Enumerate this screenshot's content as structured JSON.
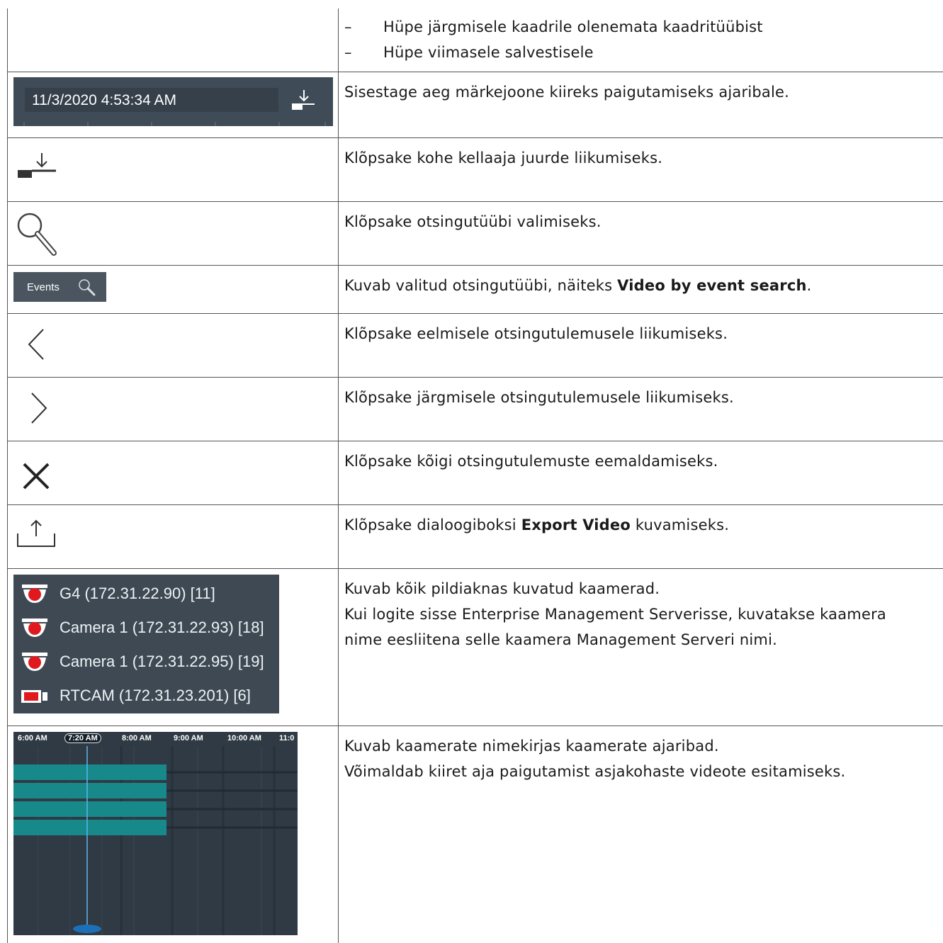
{
  "rows": [
    {
      "bullets": [
        "Hüpe järgmisele kaadrile olenemata kaadritüübist",
        "Hüpe viimasele salvestisele"
      ]
    },
    {
      "text": "Sisestage aeg märkejoone kiireks paigutamiseks ajaribale."
    },
    {
      "text": "Klõpsake kohe kellaaja juurde liikumiseks."
    },
    {
      "text": "Klõpsake otsingutüübi valimiseks."
    },
    {
      "text_before": "Kuvab valitud otsingutüübi, näiteks ",
      "bold": "Video by event search",
      "text_after": "."
    },
    {
      "text": "Klõpsake eelmisele otsingutulemusele liikumiseks."
    },
    {
      "text": "Klõpsake järgmisele otsingutulemusele liikumiseks."
    },
    {
      "text": "Klõpsake kõigi otsingutulemuste eemaldamiseks."
    },
    {
      "text_before": "Klõpsake dialoogiboksi ",
      "bold": "Export Video",
      "text_after": " kuvamiseks."
    },
    {
      "lines": [
        "Kuvab kõik pildiaknas kuvatud kaamerad.",
        "Kui logite sisse Enterprise Management Serverisse, kuvatakse kaamera",
        "nime eesliitena selle kaamera Management Serveri nimi."
      ]
    },
    {
      "lines": [
        "Kuvab kaamerate nimekirjas kaamerate ajaribad.",
        "Võimaldab kiiret aja paigutamist asjakohaste videote esitamiseks."
      ]
    }
  ],
  "time_field": {
    "value": "11/3/2020 4:53:34 AM",
    "icon": "jump-to-time-icon"
  },
  "events_button": {
    "label": "Events",
    "icon": "search-icon"
  },
  "icons": [
    "jump-to-time-icon",
    "search-icon",
    "chevron-left-icon",
    "chevron-right-icon",
    "close-icon",
    "export-icon"
  ],
  "cameras": [
    {
      "label": "G4 (172.31.22.90) [11]",
      "icon": "dome-camera-icon"
    },
    {
      "label": "Camera 1 (172.31.22.93) [18]",
      "icon": "dome-camera-icon"
    },
    {
      "label": "Camera 1 (172.31.22.95) [19]",
      "icon": "dome-camera-icon"
    },
    {
      "label": "RTCAM (172.31.23.201) [6]",
      "icon": "box-camera-icon"
    }
  ],
  "timeline": {
    "labels": [
      "6:00 AM",
      "7:20 AM",
      "8:00 AM",
      "9:00 AM",
      "10:00 AM",
      "11:0"
    ],
    "active_label": "7:20 AM",
    "colors": {
      "bar": "#17898a",
      "cursor": "#5fb4e8",
      "background": "#2f3a44"
    }
  },
  "colors": {
    "panel": "#3f4b57",
    "record_red": "#e0191f"
  }
}
